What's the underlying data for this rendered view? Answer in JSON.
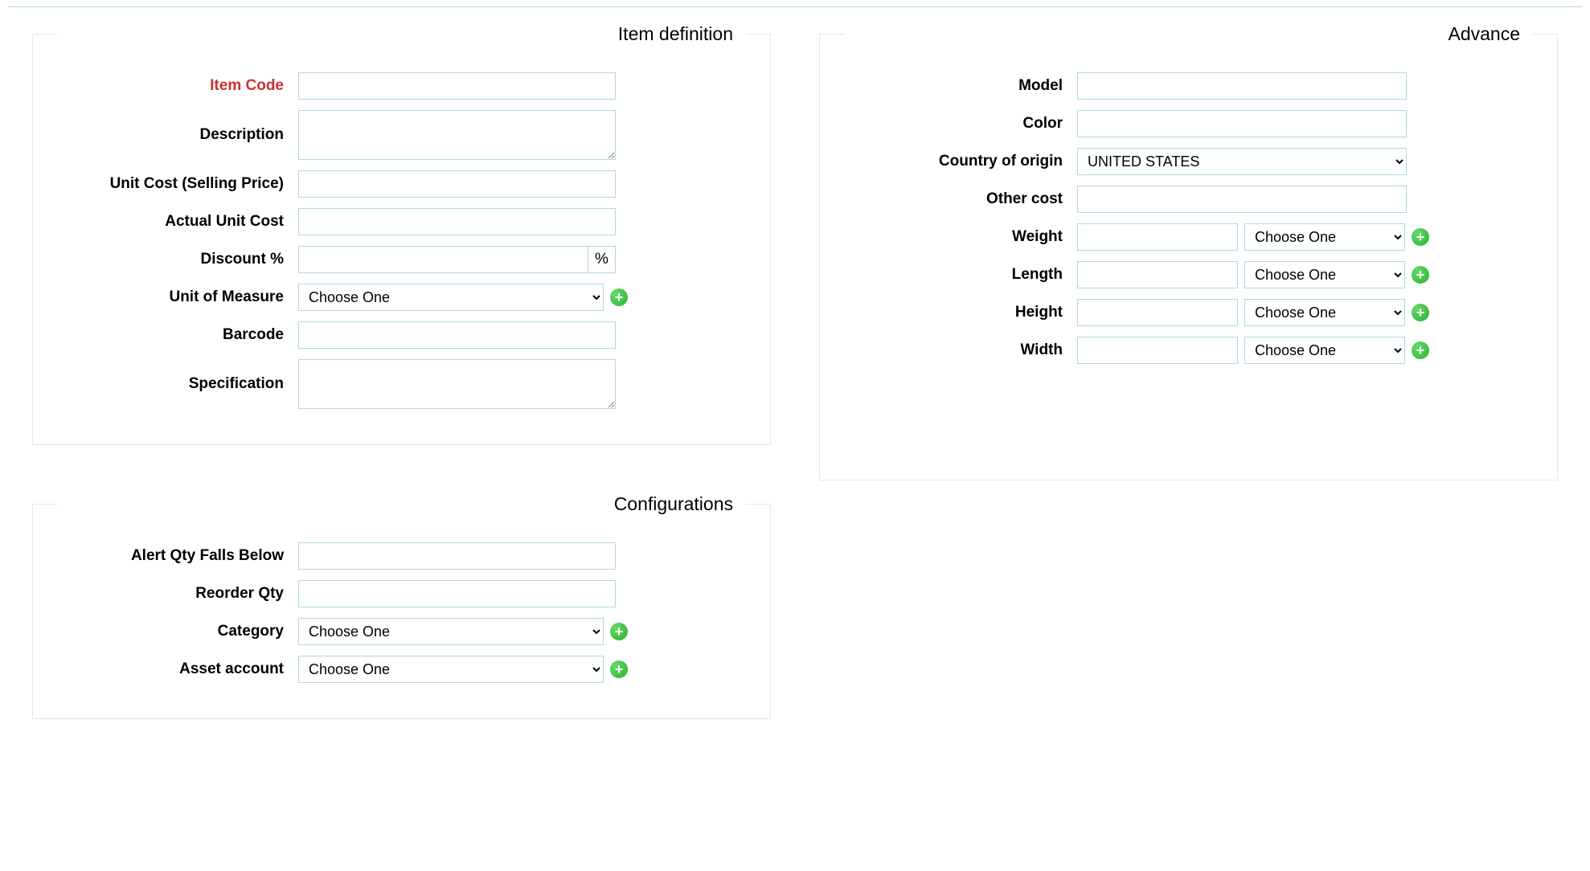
{
  "common": {
    "choose_one": "Choose One",
    "percent_symbol": "%"
  },
  "item_definition": {
    "legend": "Item definition",
    "item_code": {
      "label": "Item Code",
      "value": ""
    },
    "description": {
      "label": "Description",
      "value": ""
    },
    "unit_cost": {
      "label": "Unit Cost (Selling Price)",
      "value": ""
    },
    "actual_unit_cost": {
      "label": "Actual Unit Cost",
      "value": ""
    },
    "discount_pct": {
      "label": "Discount %",
      "value": ""
    },
    "unit_of_measure": {
      "label": "Unit of Measure"
    },
    "barcode": {
      "label": "Barcode",
      "value": ""
    },
    "specification": {
      "label": "Specification",
      "value": ""
    }
  },
  "advance": {
    "legend": "Advance",
    "model": {
      "label": "Model",
      "value": ""
    },
    "color": {
      "label": "Color",
      "value": ""
    },
    "country": {
      "label": "Country of origin",
      "value": "UNITED STATES"
    },
    "other_cost": {
      "label": "Other cost",
      "value": ""
    },
    "weight": {
      "label": "Weight",
      "value": ""
    },
    "length": {
      "label": "Length",
      "value": ""
    },
    "height": {
      "label": "Height",
      "value": ""
    },
    "width": {
      "label": "Width",
      "value": ""
    }
  },
  "configurations": {
    "legend": "Configurations",
    "alert_qty": {
      "label": "Alert Qty Falls Below",
      "value": ""
    },
    "reorder_qty": {
      "label": "Reorder Qty",
      "value": ""
    },
    "category": {
      "label": "Category"
    },
    "asset_account": {
      "label": "Asset account"
    }
  }
}
